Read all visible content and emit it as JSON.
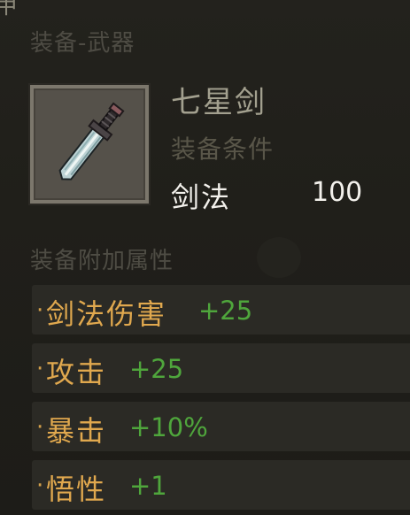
{
  "panel": {
    "corner_glyph": "甲",
    "category": "装备-武器"
  },
  "item": {
    "name": "七星剑",
    "icon": "sword-icon",
    "requirement_title": "装备条件",
    "requirement": {
      "skill": "剑法",
      "value": "100"
    }
  },
  "attributes": {
    "title": "装备附加属性",
    "bullet": "·",
    "rows": [
      {
        "label": "剑法伤害",
        "bonus": "+25"
      },
      {
        "label": "攻击",
        "bonus": "+25"
      },
      {
        "label": "暴击",
        "bonus": "+10%"
      },
      {
        "label": "悟性",
        "bonus": "+1"
      }
    ]
  },
  "colors": {
    "attribute_label": "#e0a84e",
    "bonus_value": "#4fa63c",
    "requirement_text": "#f3f1ec"
  }
}
